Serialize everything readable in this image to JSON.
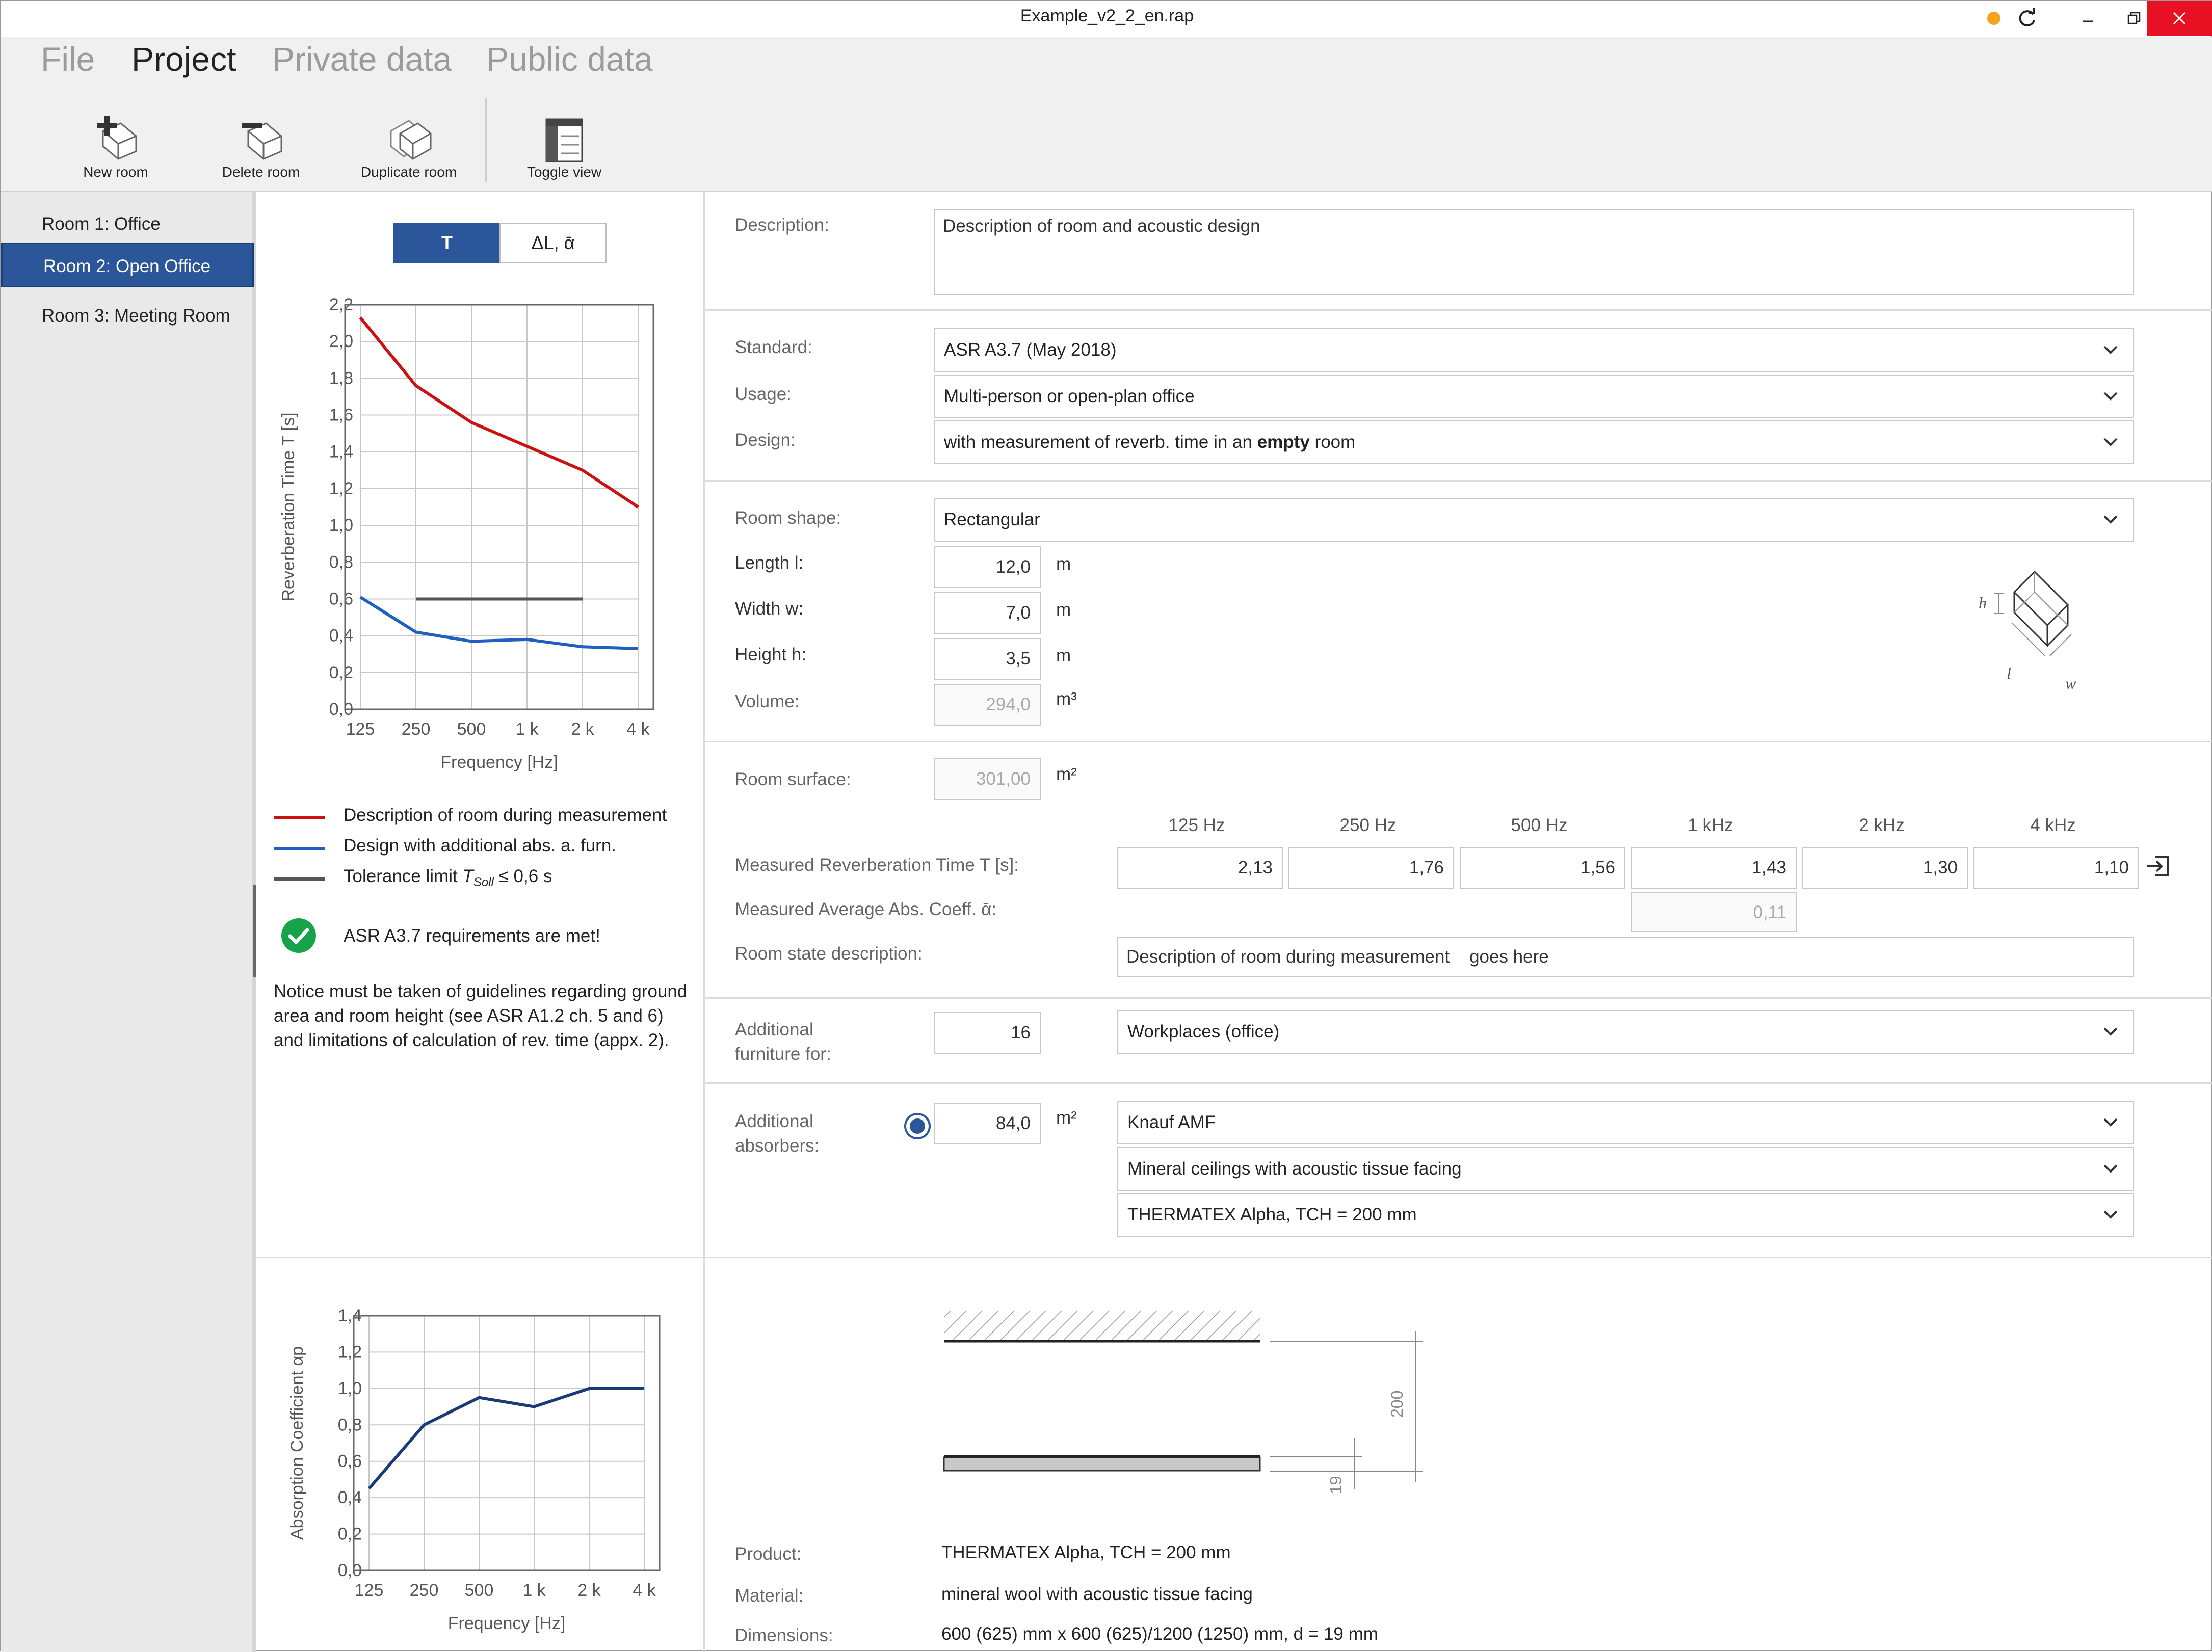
{
  "window": {
    "title": "Example_v2_2_en.rap",
    "status_color": "#f5a31a"
  },
  "menu": [
    "File",
    "Project",
    "Private data",
    "Public data"
  ],
  "menu_active": "Project",
  "toolbar": {
    "new_room": "New room",
    "delete_room": "Delete room",
    "duplicate_room": "Duplicate room",
    "toggle_view": "Toggle view"
  },
  "rooms": [
    "Room 1: Office",
    "Room 2: Open Office",
    "Room 3: Meeting Room"
  ],
  "selected_room": "Room 2: Open Office",
  "toggle": {
    "t": "T",
    "dl": "ΔL, ᾱ"
  },
  "legend": {
    "measured": "Description of room during measurement",
    "design": "Design with additional abs. a. furn.",
    "tolerance_prefix": "Tolerance limit ",
    "tolerance_sub": "Soll",
    "tolerance_suffix": " ≤ 0,6 s"
  },
  "requirement_msg": "ASR A3.7 requirements are met!",
  "notice": "Notice must be taken of guidelines regarding ground area and room height (see ASR A1.2 ch. 5 and 6) and limitations of calculation of rev. time (appx. 2).",
  "form": {
    "description_label": "Description:",
    "description_value": "Description of room and acoustic design",
    "standard_label": "Standard:",
    "standard_value": "ASR A3.7 (May 2018)",
    "usage_label": "Usage:",
    "usage_value": "Multi-person or open-plan office",
    "design_label": "Design:",
    "design_value_pre": "with measurement of reverb. time in an ",
    "design_value_bold": "empty",
    "design_value_post": " room",
    "shape_label": "Room shape:",
    "shape_value": "Rectangular",
    "length_label": "Length l:",
    "length_value": "12,0",
    "width_label": "Width w:",
    "width_value": "7,0",
    "height_label": "Height h:",
    "height_value": "3,5",
    "volume_label": "Volume:",
    "volume_value": "294,0",
    "unit_m": "m",
    "unit_m3": "m³",
    "unit_m2": "m²",
    "surface_label": "Room surface:",
    "surface_value": "301,00",
    "freq_headers": [
      "125 Hz",
      "250 Hz",
      "500 Hz",
      "1 kHz",
      "2 kHz",
      "4 kHz"
    ],
    "measured_rt_label": "Measured Reverberation Time T [s]:",
    "measured_rt_values": [
      "2,13",
      "1,76",
      "1,56",
      "1,43",
      "1,30",
      "1,10"
    ],
    "avg_abs_label": "Measured Average Abs. Coeff. ᾱ:",
    "avg_abs_value": "0,11",
    "state_label": "Room state description:",
    "state_value": "Description of room during measurement    goes here",
    "furniture_label": "Additional furniture for:",
    "furniture_count": "16",
    "furniture_type": "Workplaces (office)",
    "absorbers_label": "Additional absorbers:",
    "absorbers_area": "84,0",
    "absorber_brand": "Knauf AMF",
    "absorber_category": "Mineral ceilings with acoustic tissue facing",
    "absorber_product": "THERMATEX Alpha, TCH = 200 mm"
  },
  "cube_labels": {
    "h": "h",
    "l": "l",
    "w": "w"
  },
  "drawing_labels": {
    "d200": "200",
    "d19": "19"
  },
  "product": {
    "product_label": "Product:",
    "product_value": "THERMATEX Alpha, TCH = 200 mm",
    "material_label": "Material:",
    "material_value": "mineral wool with acoustic tissue facing",
    "dimensions_label": "Dimensions:",
    "dimensions_value": "600 (625) mm x 600 (625)/1200 (1250) mm, d = 19 mm"
  },
  "chart_data": [
    {
      "type": "line",
      "categories": [
        "125",
        "250",
        "500",
        "1 k",
        "2 k",
        "4 k"
      ],
      "series": [
        {
          "name": "Description of room during measurement",
          "color": "#cc1111",
          "values": [
            2.13,
            1.76,
            1.56,
            1.43,
            1.3,
            1.1
          ]
        },
        {
          "name": "Design with additional abs. a. furn.",
          "color": "#1f5fbf",
          "values": [
            0.61,
            0.42,
            0.37,
            0.38,
            0.34,
            0.33
          ]
        },
        {
          "name": "Tolerance limit",
          "color": "#555555",
          "values": [
            null,
            0.6,
            0.6,
            0.6,
            0.6,
            null
          ]
        }
      ],
      "xlabel": "Frequency [Hz]",
      "ylabel": "Reverberation Time T [s]",
      "ylim": [
        0,
        2.2
      ],
      "yticks": [
        "0,0",
        "0,2",
        "0,4",
        "0,6",
        "0,8",
        "1,0",
        "1,2",
        "1,4",
        "1,6",
        "1,8",
        "2,0",
        "2,2"
      ],
      "grid": true
    },
    {
      "type": "line",
      "categories": [
        "125",
        "250",
        "500",
        "1 k",
        "2 k",
        "4 k"
      ],
      "series": [
        {
          "color": "#1a3a78",
          "values": [
            0.45,
            0.8,
            0.95,
            0.9,
            1.0,
            1.0
          ]
        }
      ],
      "xlabel": "Frequency [Hz]",
      "ylabel": "Absorption Coefficient αp",
      "ylim": [
        0,
        1.4
      ],
      "yticks": [
        "0,0",
        "0,2",
        "0,4",
        "0,6",
        "0,8",
        "1,0",
        "1,2",
        "1,4"
      ],
      "grid": true
    }
  ]
}
